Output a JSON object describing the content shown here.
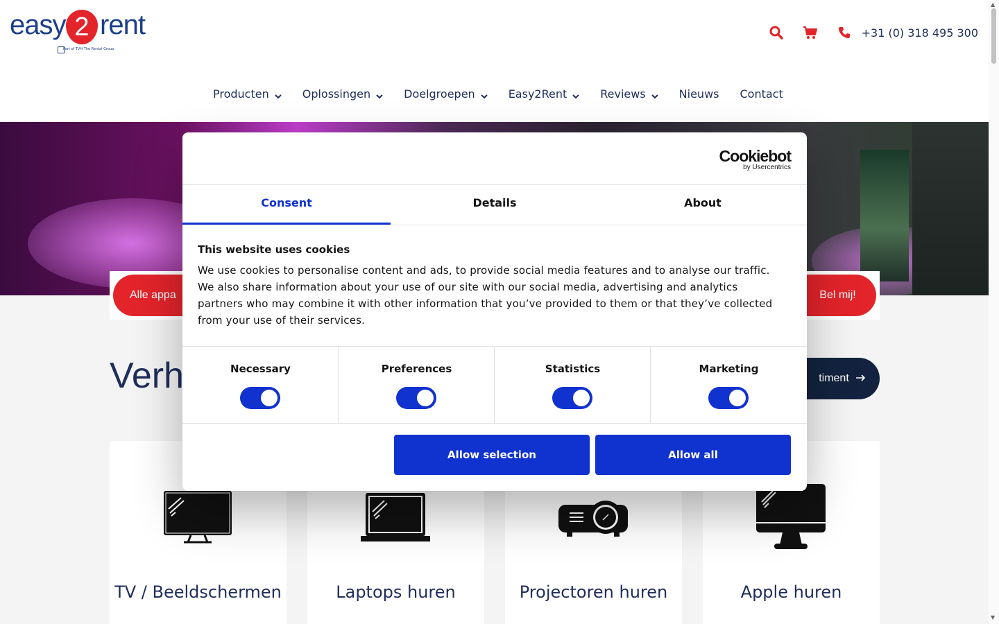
{
  "header": {
    "logo": {
      "part1": "easy",
      "part2": "2",
      "part3": "rent",
      "sub": "Part of TVH The Rental Group"
    },
    "phone": "+31 (0) 318 495 300"
  },
  "nav": {
    "items": [
      {
        "label": "Producten",
        "dropdown": true
      },
      {
        "label": "Oplossingen",
        "dropdown": true
      },
      {
        "label": "Doelgroepen",
        "dropdown": true
      },
      {
        "label": "Easy2Rent",
        "dropdown": true
      },
      {
        "label": "Reviews",
        "dropdown": true
      },
      {
        "label": "Nieuws",
        "dropdown": false
      },
      {
        "label": "Contact",
        "dropdown": false
      }
    ]
  },
  "hero": {
    "left_button": "Alle appa",
    "right_button": "Bel mij!"
  },
  "section": {
    "title": "Verh",
    "assortment_button": "timent"
  },
  "cards": [
    {
      "title": "TV / Beeldschermen",
      "icon": "tv-icon"
    },
    {
      "title": "Laptops huren",
      "icon": "laptop-icon"
    },
    {
      "title": "Projectoren huren",
      "icon": "projector-icon"
    },
    {
      "title": "Apple huren",
      "icon": "imac-icon"
    }
  ],
  "cookie": {
    "brand": "Cookiebot",
    "brand_sub": "by Usercentrics",
    "tabs": [
      "Consent",
      "Details",
      "About"
    ],
    "active_tab": "Consent",
    "heading": "This website uses cookies",
    "body": "We use cookies to personalise content and ads, to provide social media features and to analyse our traffic. We also share information about your use of our site with our social media, advertising and analytics partners who may combine it with other information that you’ve provided to them or that they’ve collected from your use of their services.",
    "categories": [
      {
        "label": "Necessary",
        "enabled": true
      },
      {
        "label": "Preferences",
        "enabled": true
      },
      {
        "label": "Statistics",
        "enabled": true
      },
      {
        "label": "Marketing",
        "enabled": true
      }
    ],
    "btn_selection": "Allow selection",
    "btn_all": "Allow all"
  },
  "colors": {
    "brand_red": "#e3242b",
    "brand_navy": "#1f2d5a",
    "cookie_blue": "#1032cf"
  }
}
